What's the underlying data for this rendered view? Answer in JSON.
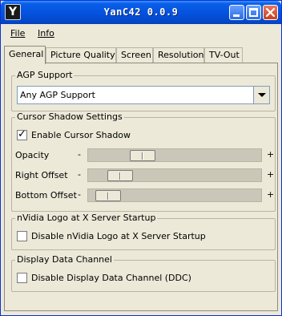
{
  "window": {
    "title": "YanC42 0.0.9",
    "icon_letter": "Y"
  },
  "menu": {
    "file": "File",
    "info": "Info"
  },
  "tabs": [
    "General",
    "Picture Quality",
    "Screen",
    "Resolution",
    "TV-Out"
  ],
  "active_tab": "General",
  "agp": {
    "title": "AGP Support",
    "selected": "Any AGP Support"
  },
  "cursor": {
    "title": "Cursor Shadow Settings",
    "enable_label": "Enable Cursor Shadow",
    "enable_checked": true,
    "sliders": [
      {
        "label": "Opacity",
        "minus": "-",
        "plus": "+",
        "level": 0.28
      },
      {
        "label": "Right Offset",
        "minus": "-",
        "plus": "+",
        "level": 0.13
      },
      {
        "label": "Bottom Offset",
        "minus": "-",
        "plus": "+",
        "level": 0.05
      }
    ]
  },
  "nvidia": {
    "title": "nVidia Logo at X Server Startup",
    "label": "Disable nVidia Logo at X Server Startup",
    "checked": false
  },
  "ddc": {
    "title": "Display Data Channel",
    "label": "Disable Display Data Channel (DDC)",
    "checked": false
  },
  "colors": {
    "titlebar": "#0553e0",
    "window_bg": "#ece9d8",
    "close_button": "#d8492c"
  }
}
